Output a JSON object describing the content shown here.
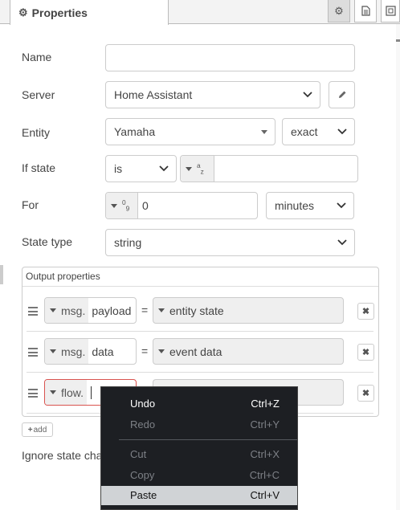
{
  "header": {
    "title": "Properties",
    "icons": [
      "gear-icon",
      "document-icon",
      "frame-icon"
    ]
  },
  "form": {
    "name_label": "Name",
    "name_value": "",
    "server_label": "Server",
    "server_value": "Home Assistant",
    "entity_label": "Entity",
    "entity_value": "Yamaha",
    "entity_match": "exact",
    "ifstate_label": "If state",
    "ifstate_op": "is",
    "ifstate_type_glyph": "a z",
    "ifstate_value": "",
    "for_label": "For",
    "for_type_glyph": "0 9",
    "for_value": "0",
    "for_unit": "minutes",
    "statetype_label": "State type",
    "statetype_value": "string"
  },
  "output": {
    "title": "Output properties",
    "rows": [
      {
        "prefix": "msg.",
        "name": "payload",
        "eq": "=",
        "value": "entity state"
      },
      {
        "prefix": "msg.",
        "name": "data",
        "eq": "=",
        "value": "event data"
      },
      {
        "prefix": "flow.",
        "name": "",
        "eq": "",
        "value": ""
      }
    ],
    "add_label": "add"
  },
  "ignore_label": "Ignore state cha",
  "context_menu": {
    "items": [
      {
        "label": "Undo",
        "shortcut": "Ctrl+Z",
        "enabled": true
      },
      {
        "label": "Redo",
        "shortcut": "Ctrl+Y",
        "enabled": false
      },
      {
        "label": "Cut",
        "shortcut": "Ctrl+X",
        "enabled": false
      },
      {
        "label": "Copy",
        "shortcut": "Ctrl+C",
        "enabled": false
      },
      {
        "label": "Paste",
        "shortcut": "Ctrl+V",
        "enabled": true,
        "highlighted": true
      }
    ]
  },
  "colors": {
    "accent_error": "#d9534f",
    "menu_bg": "#1d1f23",
    "menu_highlight": "#d0d3d6"
  }
}
